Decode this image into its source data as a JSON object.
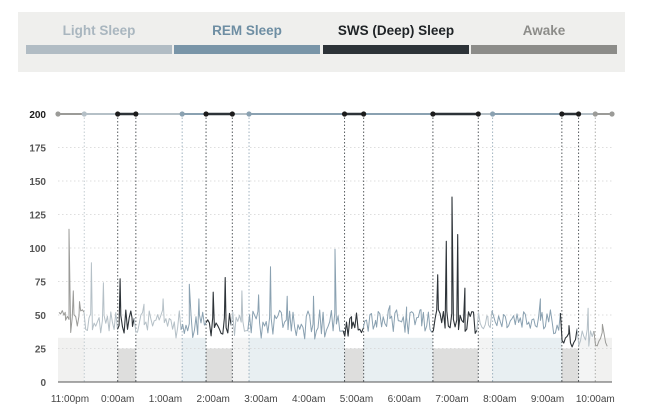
{
  "legend": [
    {
      "label": "Light Sleep",
      "color": "#b1bcc4",
      "text_color": "#a9b6bf"
    },
    {
      "label": "REM Sleep",
      "color": "#7995a8",
      "text_color": "#6e8ea3"
    },
    {
      "label": "SWS (Deep) Sleep",
      "color": "#2d3338",
      "text_color": "#1f2326"
    },
    {
      "label": "Awake",
      "color": "#8c8c89",
      "text_color": "#8c8c89"
    }
  ],
  "chart_data": {
    "type": "line",
    "ylim": [
      0,
      200
    ],
    "y_ticks": [
      0,
      25,
      50,
      75,
      100,
      125,
      150,
      175,
      200
    ],
    "x_range": [
      -1.25,
      10.35
    ],
    "x_ticks": [
      {
        "label": "11:00pm",
        "value": -1
      },
      {
        "label": "0:00am",
        "value": 0
      },
      {
        "label": "1:00am",
        "value": 1
      },
      {
        "label": "2:00am",
        "value": 2
      },
      {
        "label": "3:00am",
        "value": 3
      },
      {
        "label": "4:00am",
        "value": 4
      },
      {
        "label": "5:00am",
        "value": 5
      },
      {
        "label": "6:00am",
        "value": 6
      },
      {
        "label": "7:00am",
        "value": 7
      },
      {
        "label": "8:00am",
        "value": 8
      },
      {
        "label": "9:00am",
        "value": 9
      },
      {
        "label": "10:00am",
        "value": 10
      }
    ],
    "stage_colors": {
      "awake": "#9b9b98",
      "light": "#b5c0c7",
      "rem": "#8aa1b1",
      "deep": "#2d3338"
    },
    "band_fills": {
      "awake": "#f1f1f0",
      "light": "#f3f4f4",
      "rem": "#e8eff2",
      "deep": "#dededd"
    },
    "segments": [
      {
        "stage": "awake",
        "start": -1.25,
        "end": -0.7
      },
      {
        "stage": "light",
        "start": -0.7,
        "end": 0.0
      },
      {
        "stage": "deep",
        "start": 0.0,
        "end": 0.38
      },
      {
        "stage": "light",
        "start": 0.38,
        "end": 1.35
      },
      {
        "stage": "rem",
        "start": 1.35,
        "end": 1.85
      },
      {
        "stage": "deep",
        "start": 1.85,
        "end": 2.4
      },
      {
        "stage": "light",
        "start": 2.4,
        "end": 2.75
      },
      {
        "stage": "rem",
        "start": 2.75,
        "end": 4.75
      },
      {
        "stage": "deep",
        "start": 4.75,
        "end": 5.15
      },
      {
        "stage": "rem",
        "start": 5.15,
        "end": 6.6
      },
      {
        "stage": "deep",
        "start": 6.6,
        "end": 7.55
      },
      {
        "stage": "light",
        "start": 7.55,
        "end": 7.85
      },
      {
        "stage": "rem",
        "start": 7.85,
        "end": 9.3
      },
      {
        "stage": "deep",
        "start": 9.3,
        "end": 9.65
      },
      {
        "stage": "light",
        "start": 9.65,
        "end": 10.0
      },
      {
        "stage": "awake",
        "start": 10.0,
        "end": 10.35
      }
    ],
    "spikes": [
      {
        "x": -1.1,
        "y": 52
      },
      {
        "x": -1.02,
        "y": 114
      },
      {
        "x": -0.93,
        "y": 68
      },
      {
        "x": -0.8,
        "y": 60
      },
      {
        "x": -0.55,
        "y": 89
      },
      {
        "x": -0.3,
        "y": 74
      },
      {
        "x": 0.05,
        "y": 77
      },
      {
        "x": 0.3,
        "y": 48
      },
      {
        "x": 0.55,
        "y": 58
      },
      {
        "x": 0.95,
        "y": 62
      },
      {
        "x": 1.5,
        "y": 73
      },
      {
        "x": 1.7,
        "y": 62
      },
      {
        "x": 2.0,
        "y": 67
      },
      {
        "x": 2.25,
        "y": 78
      },
      {
        "x": 2.6,
        "y": 68
      },
      {
        "x": 2.95,
        "y": 65
      },
      {
        "x": 3.2,
        "y": 86
      },
      {
        "x": 3.55,
        "y": 64
      },
      {
        "x": 4.1,
        "y": 64
      },
      {
        "x": 4.55,
        "y": 99
      },
      {
        "x": 4.9,
        "y": 40
      },
      {
        "x": 5.4,
        "y": 46
      },
      {
        "x": 5.7,
        "y": 57
      },
      {
        "x": 6.05,
        "y": 56
      },
      {
        "x": 6.35,
        "y": 54
      },
      {
        "x": 6.7,
        "y": 80
      },
      {
        "x": 6.88,
        "y": 105
      },
      {
        "x": 7.0,
        "y": 138
      },
      {
        "x": 7.12,
        "y": 110
      },
      {
        "x": 7.27,
        "y": 70
      },
      {
        "x": 7.75,
        "y": 49
      },
      {
        "x": 8.15,
        "y": 43
      },
      {
        "x": 8.6,
        "y": 44
      },
      {
        "x": 8.85,
        "y": 62
      },
      {
        "x": 9.45,
        "y": 42
      },
      {
        "x": 9.85,
        "y": 55
      },
      {
        "x": 10.15,
        "y": 43
      }
    ]
  }
}
